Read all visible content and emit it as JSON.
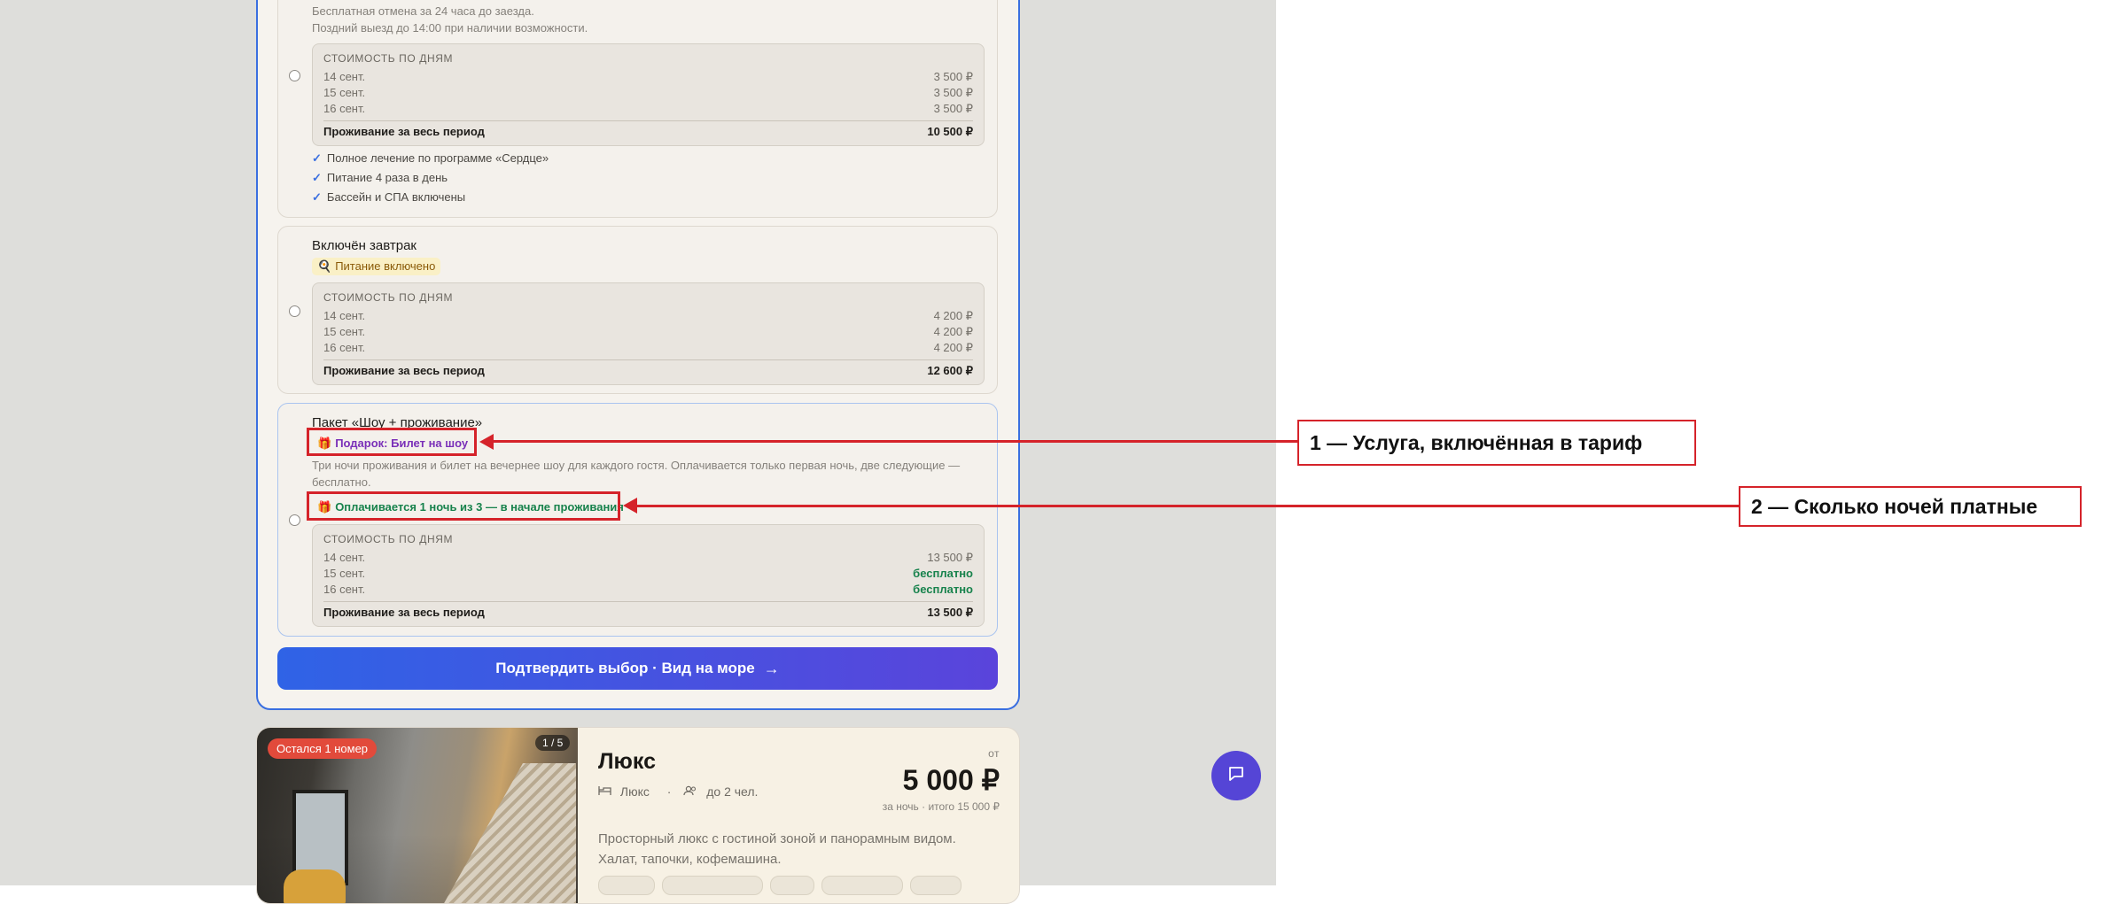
{
  "rate_top": {
    "policy_lines": [
      "Бесплатная отмена за 24 часа до заезда.",
      "Поздний выезд до 14:00 при наличии возможности."
    ],
    "price_box": {
      "heading": "стоимость по дням",
      "days": [
        {
          "date": "14 сент.",
          "price": "3 500 ₽"
        },
        {
          "date": "15 сент.",
          "price": "3 500 ₽"
        },
        {
          "date": "16 сент.",
          "price": "3 500 ₽"
        }
      ],
      "total_label": "Проживание за весь период",
      "total": "10 500 ₽"
    },
    "features": [
      "Полное лечение по программе «Сердце»",
      "Питание 4 раза в день",
      "Бассейн и СПА включены"
    ]
  },
  "rate_breakfast": {
    "title": "Включён завтрак",
    "badge": "Питание включено",
    "price_box": {
      "heading": "стоимость по дням",
      "days": [
        {
          "date": "14 сент.",
          "price": "4 200 ₽"
        },
        {
          "date": "15 сент.",
          "price": "4 200 ₽"
        },
        {
          "date": "16 сент.",
          "price": "4 200 ₽"
        }
      ],
      "total_label": "Проживание за весь период",
      "total": "12 600 ₽"
    }
  },
  "rate_show": {
    "title": "Пакет «Шоу + проживание»",
    "gift_badge": "Подарок: Билет на шоу",
    "description": "Три ночи проживания и билет на вечернее шоу для каждого гостя. Оплачивается только первая ночь, две следующие — бесплатно.",
    "paid_badge": "Оплачивается 1 ночь из 3 — в начале проживания",
    "price_box": {
      "heading": "стоимость по дням",
      "days": [
        {
          "date": "14 сент.",
          "price": "13 500 ₽"
        },
        {
          "date": "15 сент.",
          "price": "бесплатно"
        },
        {
          "date": "16 сент.",
          "price": "бесплатно"
        }
      ],
      "total_label": "Проживание за весь период",
      "total": "13 500 ₽"
    }
  },
  "confirm_button": "Подтвердить выбор · Вид на море",
  "next_room": {
    "left_badge": "Остался 1 номер",
    "photo_counter": "1 / 5",
    "title": "Люкс",
    "type": "Люкс",
    "meta_sep": "·",
    "guests": "до 2 чел.",
    "from_label": "от",
    "price": "5 000 ₽",
    "price_sub": "за ночь · итого 15 000 ₽",
    "description": "Просторный люкс с гостиной зоной и панорамным видом. Халат, тапочки, кофемашина."
  },
  "annotations": [
    {
      "label": "1 — Услуга, включённая в тариф"
    },
    {
      "label": "2 — Сколько ночей платные"
    }
  ],
  "colors": {
    "accent": "#3a6fe0",
    "annotation": "#d5232a",
    "free": "#17824c",
    "chat": "#5545d6"
  },
  "icons": {
    "check": "✓",
    "gift": "🎁",
    "food": "🍳",
    "arrow": "→",
    "bed": "bed-icon",
    "guests": "users-icon"
  }
}
